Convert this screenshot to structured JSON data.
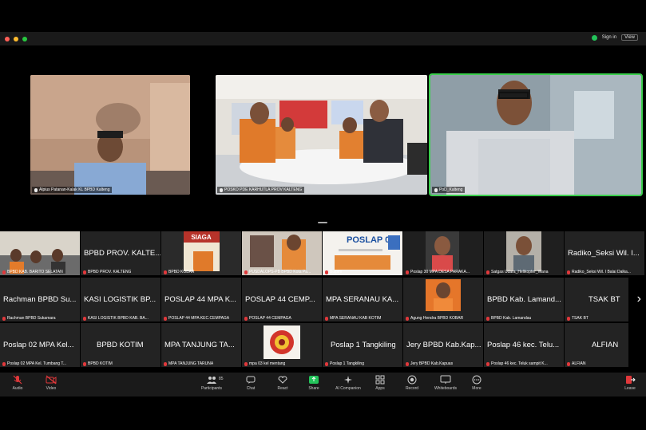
{
  "titlebar": {
    "signin": "Sign in",
    "view": "View"
  },
  "speakers": [
    {
      "name": "Alpius Patanan-Kalak KL BPBD Kalteng"
    },
    {
      "name": "POSKO PDE KARHUTLA PROV KALTENG"
    },
    {
      "name": "PoD_Kalteng"
    }
  ],
  "gallery": {
    "row1": [
      {
        "big": "",
        "small": "BPBD KAB. BARITO SELATAN"
      },
      {
        "big": "BPBD PROV. KALTE...",
        "small": "BPBD PROV. KALTENG"
      },
      {
        "big": "",
        "small": "BPBD KOBAR",
        "sign": "SIAGA"
      },
      {
        "big": "",
        "small": "PUSDALOPS-PB BPBD Kota Pa..."
      },
      {
        "big": "",
        "small": "Bulpim",
        "poster": "POSLAP 01"
      },
      {
        "big": "",
        "small": "Poslap 30 MPA DESA PARAKA..."
      },
      {
        "big": "",
        "small": "Satgas Udara_Helikopter_Wana"
      },
      {
        "big": "Radiko_Seksi Wil. I...",
        "small": "Radiko_Seksi Wil. I Balai Dalka..."
      }
    ],
    "row2": [
      {
        "big": "Rachman BPBD Su...",
        "small": "Rachman BPBD Sukamara"
      },
      {
        "big": "KASI LOGISTIK BP...",
        "small": "KASI LOGISTIK BPBD KAB. BA..."
      },
      {
        "big": "POSLAP 44 MPA K...",
        "small": "POSLAP 44 MPA KEC.CEMPAGA"
      },
      {
        "big": "POSLAP 44 CEMP...",
        "small": "POSLAP 44 CEMPAGA"
      },
      {
        "big": "MPA SERANAU KA...",
        "small": "MPA SERANAU KAB KOTIM"
      },
      {
        "big": "",
        "small": "Agung Hendra BPBD KOBAR"
      },
      {
        "big": "BPBD Kab. Lamand...",
        "small": "BPBD Kab. Lamandau"
      },
      {
        "big": "TSAK BT",
        "small": "TSAK BT"
      }
    ],
    "row3": [
      {
        "big": "Poslap 02 MPA Kel...",
        "small": "Poslap 02 MPA Kel. Tumbang T..."
      },
      {
        "big": "BPBD KOTIM",
        "small": "BPBD KOTIM"
      },
      {
        "big": "MPA TANJUNG TA...",
        "small": "MPA TANJUNG TARUNA"
      },
      {
        "big": "",
        "small": "mpa 03 kel mentang"
      },
      {
        "big": "Poslap 1 Tangkiling",
        "small": "Poslap 1 Tangkiling"
      },
      {
        "big": "Jery BPBD Kab.Kap...",
        "small": "Jery BPBD Kab.Kapuas"
      },
      {
        "big": "Poslap 46 kec. Telu...",
        "small": "Poslap 46 kec. Teluk sampit K..."
      },
      {
        "big": "ALFIAN",
        "small": "ALFIAN"
      }
    ]
  },
  "toolbar": {
    "audio": "Audio",
    "video": "Video",
    "participants": "Participants",
    "participants_count": "85",
    "chat": "Chat",
    "react": "React",
    "share": "Share",
    "ai": "AI Companion",
    "apps": "Apps",
    "record": "Record",
    "whiteboards": "Whiteboards",
    "more": "More",
    "leave": "Leave"
  },
  "colors": {
    "active_speaker": "#3ccf4e",
    "share_green": "#23c35a",
    "leave_red": "#e0383b",
    "muted_red": "#e0383b"
  }
}
